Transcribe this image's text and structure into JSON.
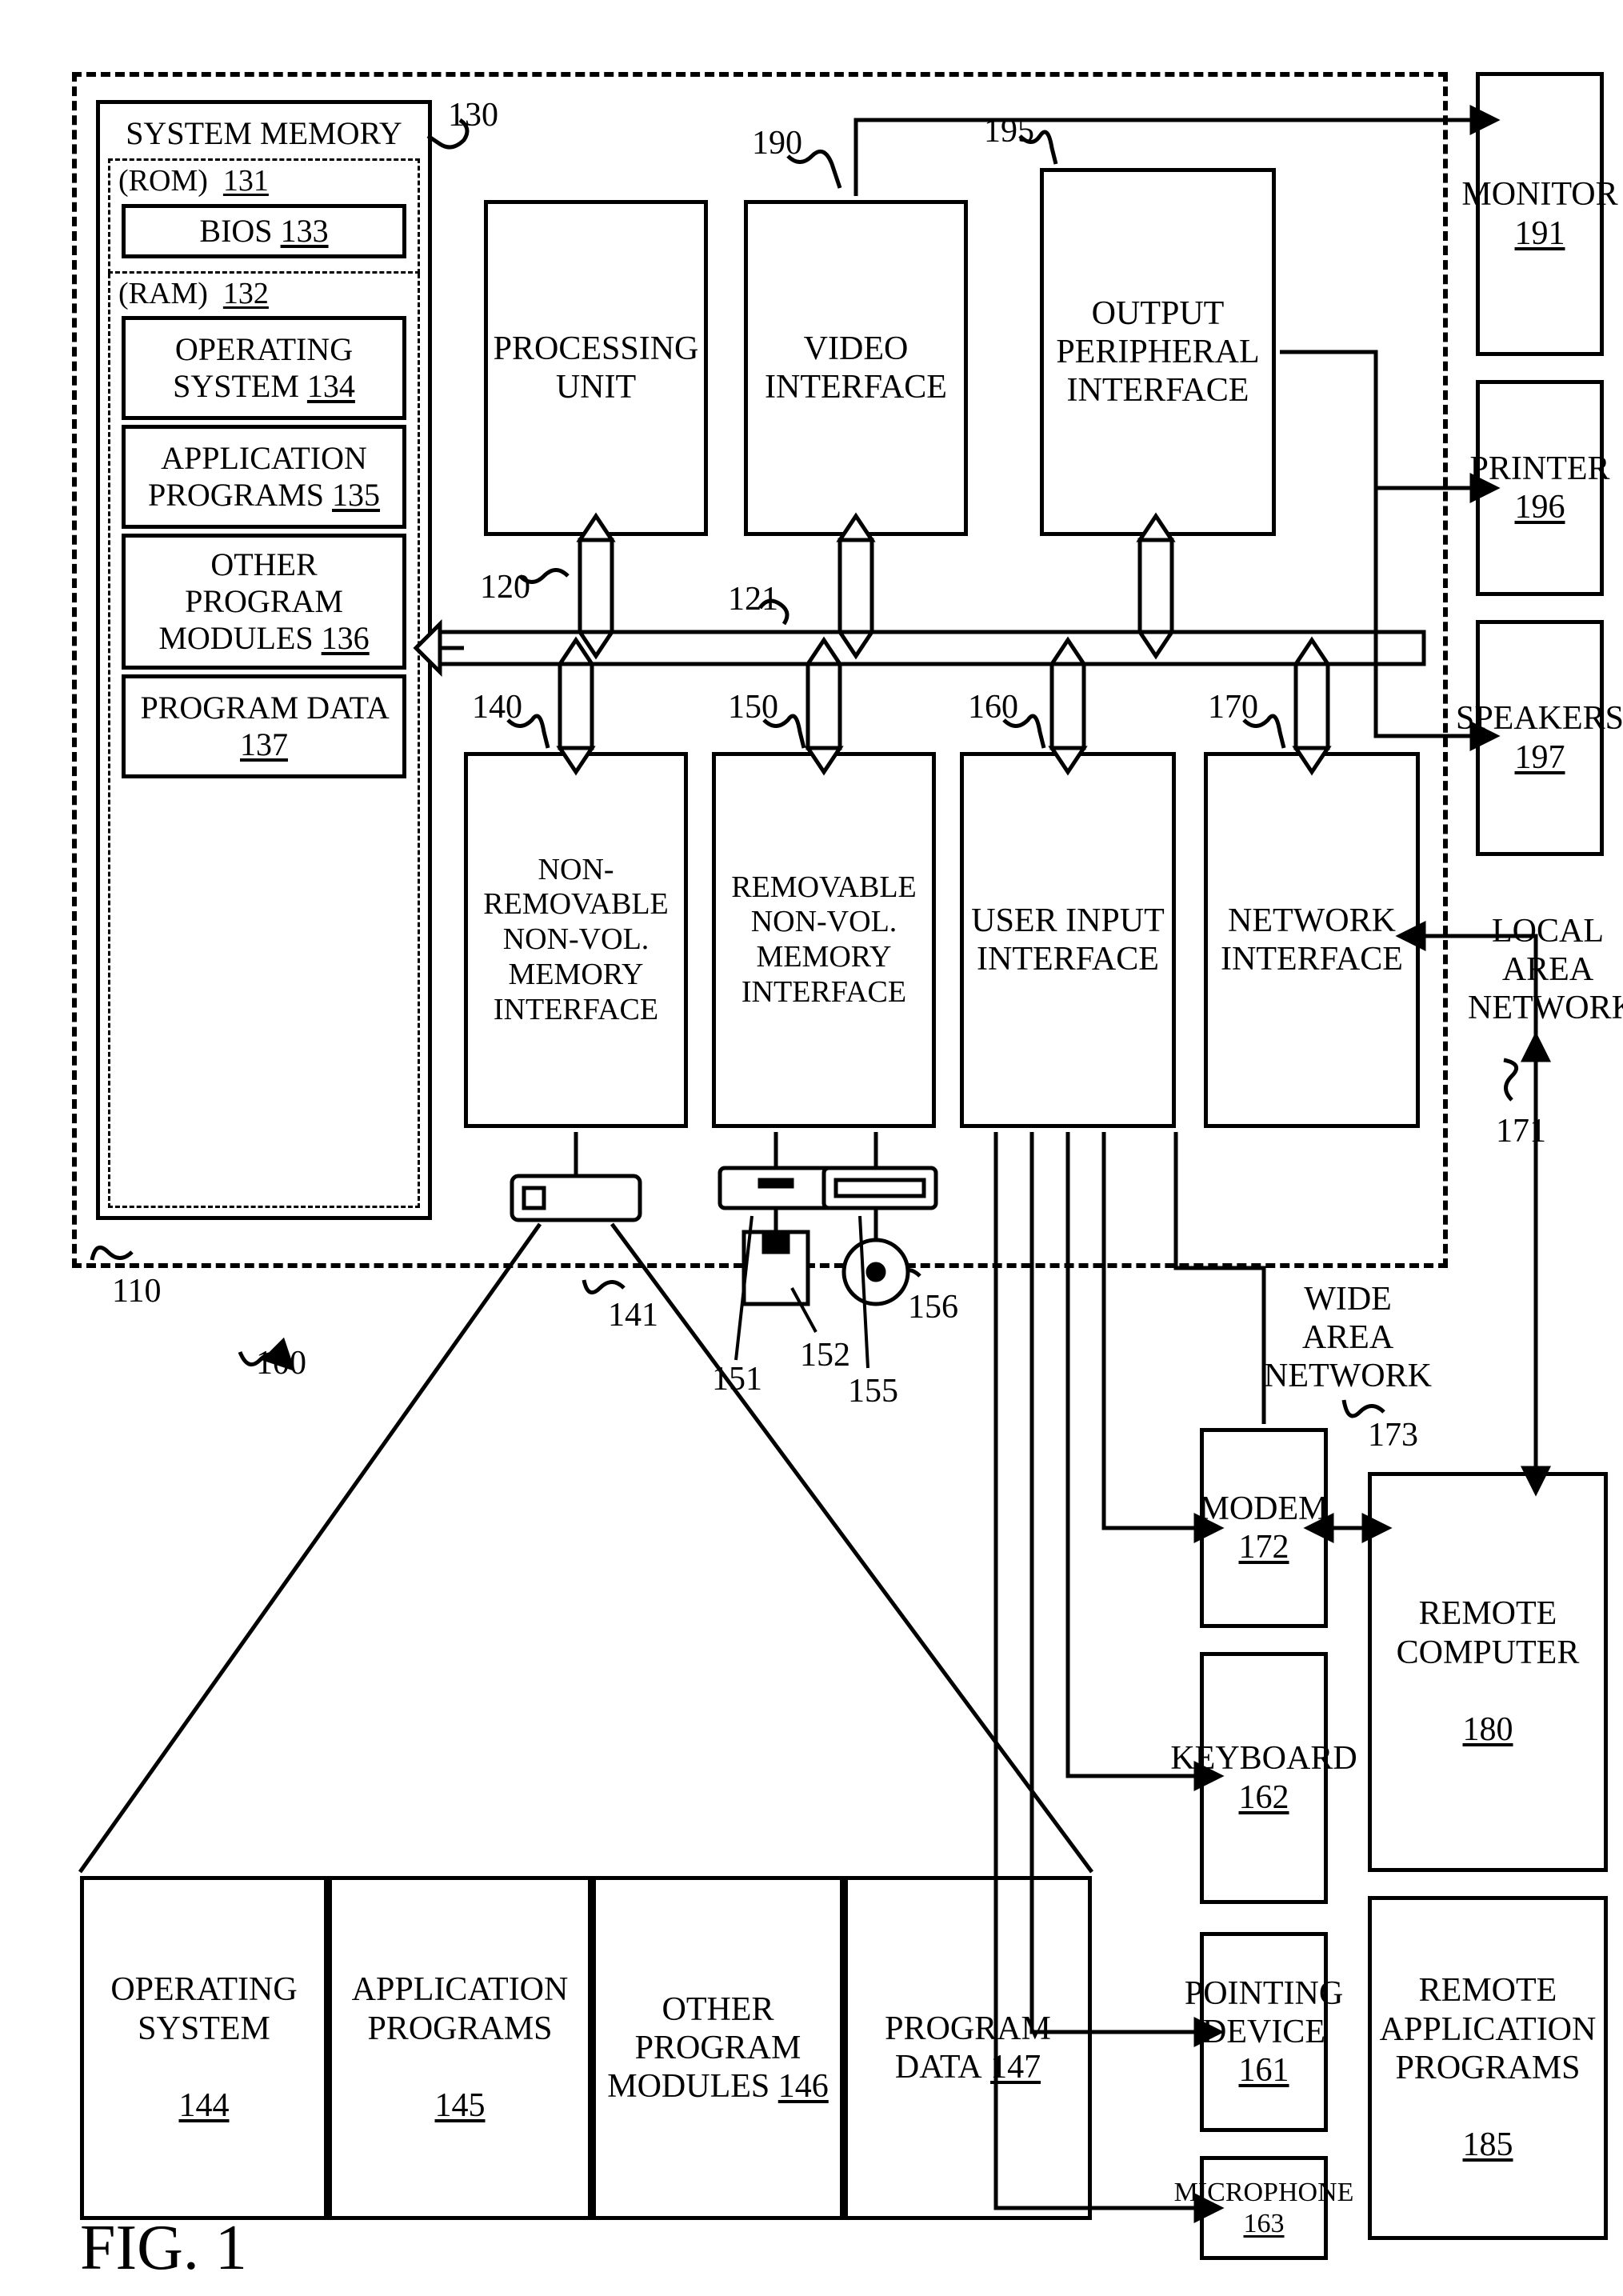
{
  "figure_label": "FIG. 1",
  "refs": {
    "computer": "110",
    "overall": "100",
    "proc_unit": "120",
    "proc_ref": "120",
    "sys_bus": "121",
    "sys_mem_ref": "130",
    "rom": "131",
    "ram": "132",
    "bios": "133",
    "os_ram": "134",
    "app_ram": "135",
    "mod_ram": "136",
    "data_ram": "137",
    "nonremov_if": "140",
    "hdd": "141",
    "remov_if": "150",
    "floppy": "151",
    "floppy_media": "152",
    "optical": "155",
    "disc": "156",
    "user_if": "160",
    "net_if": "170",
    "lan": "171",
    "modem": "172",
    "wan_link": "173",
    "remote": "180",
    "remote_apps": "185",
    "video_if": "190",
    "monitor": "191",
    "out_if_ref": "195",
    "printer": "196",
    "speakers": "197",
    "os_hdd": "144",
    "app_hdd": "145",
    "mod_hdd": "146",
    "data_hdd": "147",
    "pointing": "161",
    "keyboard": "162",
    "mic": "163"
  },
  "text": {
    "sys_mem": "SYSTEM MEMORY",
    "rom": "(ROM)",
    "bios": "BIOS",
    "ram": "(RAM)",
    "os": "OPERATING SYSTEM",
    "apps": "APPLICATION PROGRAMS",
    "other_mods": "OTHER PROGRAM MODULES",
    "prog_data": "PROGRAM DATA",
    "proc_unit": "PROCESSING UNIT",
    "video_if": "VIDEO INTERFACE",
    "out_periph_if": "OUTPUT PERIPHERAL INTERFACE",
    "nonremov": "NON-REMOVABLE NON-VOL. MEMORY INTERFACE",
    "remov": "REMOVABLE NON-VOL. MEMORY INTERFACE",
    "user_input_if": "USER INPUT INTERFACE",
    "net_if": "NETWORK INTERFACE",
    "monitor": "MONITOR",
    "printer": "PRINTER",
    "speakers": "SPEAKERS",
    "lan": "LOCAL AREA NETWORK",
    "wan": "WIDE AREA NETWORK",
    "modem": "MODEM",
    "keyboard": "KEYBOARD",
    "pointing": "POINTING DEVICE",
    "microphone": "MICROPHONE",
    "remote_comp": "REMOTE COMPUTER",
    "remote_apps": "REMOTE APPLICATION PROGRAMS",
    "os2": "OPERATING SYSTEM",
    "apps2": "APPLICATION PROGRAMS",
    "mods2": "OTHER PROGRAM MODULES",
    "data2": "PROGRAM DATA"
  }
}
